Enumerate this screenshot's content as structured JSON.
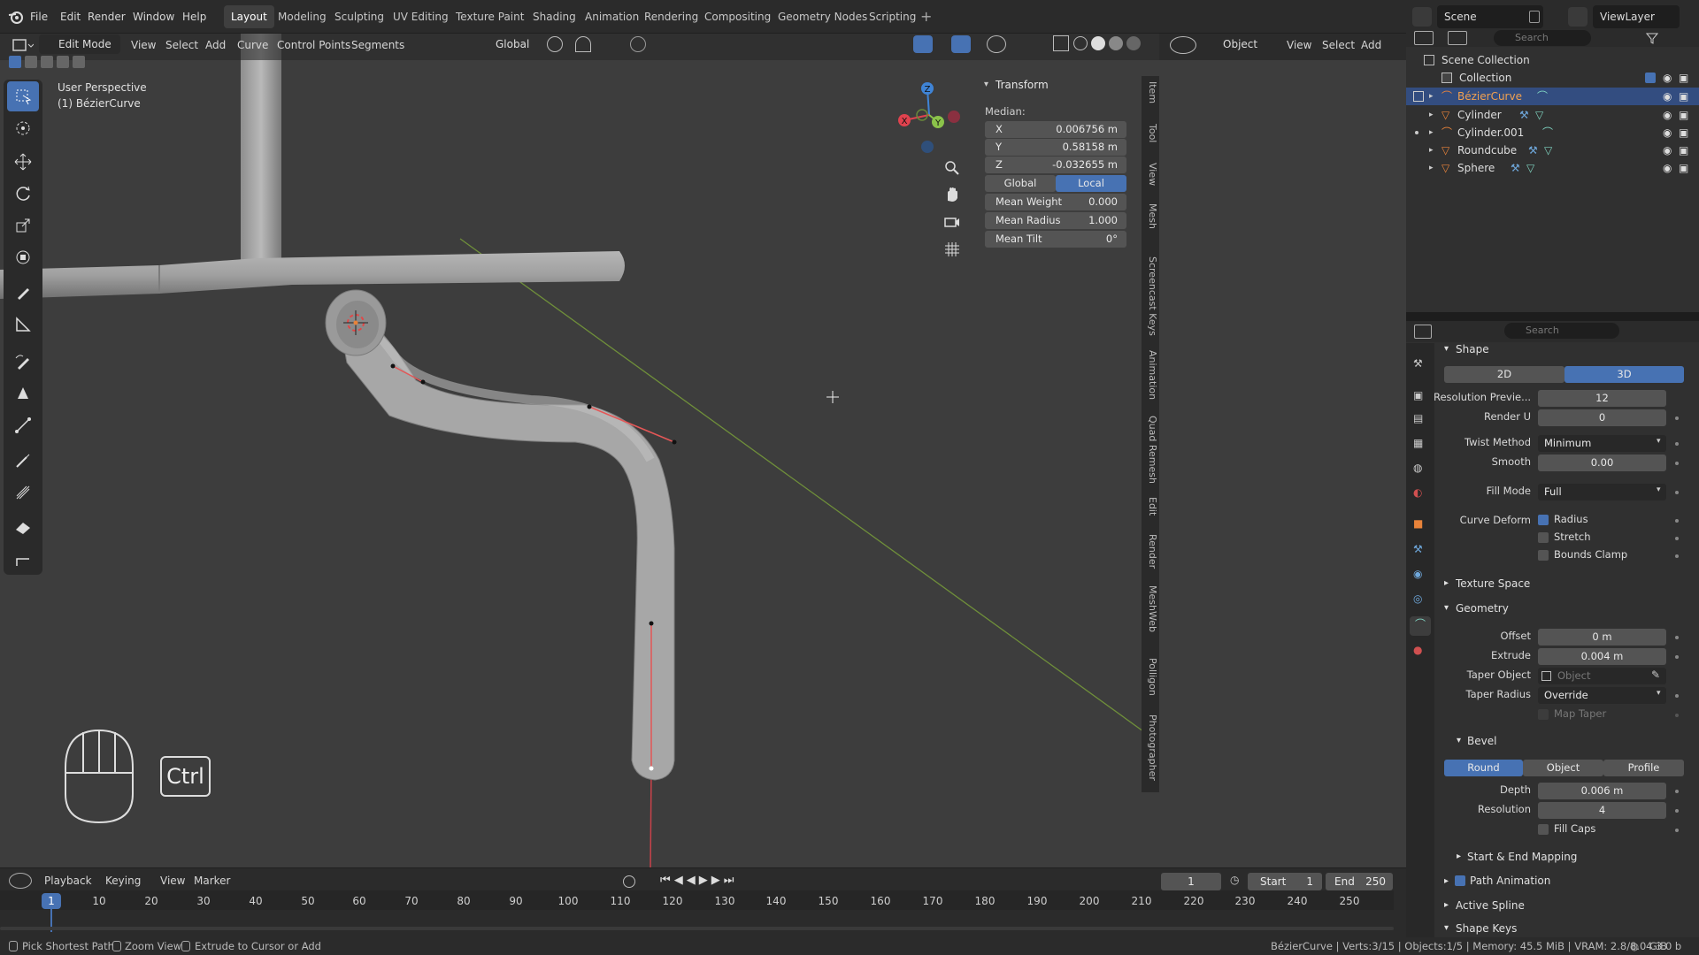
{
  "menu": {
    "file": "File",
    "edit": "Edit",
    "render": "Render",
    "window": "Window",
    "help": "Help"
  },
  "workspaces": [
    "Layout",
    "Modeling",
    "Sculpting",
    "UV Editing",
    "Texture Paint",
    "Shading",
    "Animation",
    "Rendering",
    "Compositing",
    "Geometry Nodes",
    "Scripting"
  ],
  "scene": {
    "label": "Scene",
    "view_layer": "ViewLayer"
  },
  "viewport_header": {
    "mode": "Edit Mode",
    "view": "View",
    "select": "Select",
    "add": "Add",
    "curve": "Curve",
    "control_points": "Control Points",
    "segments": "Segments",
    "orientation": "Global",
    "object_mode": "Object",
    "view2": "View",
    "select2": "Select",
    "add2": "Add",
    "search_placeholder": "Search"
  },
  "viewport": {
    "perspective": "User Perspective",
    "object_name": "(1) BézierCurve",
    "ctrl_key": "Ctrl"
  },
  "gizmo": {
    "x": "X",
    "y": "Y",
    "z": "Z"
  },
  "npanel": {
    "title": "Transform",
    "median": "Median:",
    "x_label": "X",
    "x_value": "0.006756 m",
    "y_label": "Y",
    "y_value": "0.58158 m",
    "z_label": "Z",
    "z_value": "-0.032655 m",
    "global": "Global",
    "local": "Local",
    "mean_weight_label": "Mean Weight",
    "mean_weight": "0.000",
    "mean_radius_label": "Mean Radius",
    "mean_radius": "1.000",
    "mean_tilt_label": "Mean Tilt",
    "mean_tilt": "0°"
  },
  "sidebar_tabs": [
    "Item",
    "Tool",
    "View",
    "Mesh",
    "Screencast Keys",
    "Animation",
    "Quad Remesh",
    "Edit",
    "Render",
    "MeshWeb",
    "Polligon",
    "Photographer"
  ],
  "outliner": {
    "search_placeholder": "Search",
    "scene_collection": "Scene Collection",
    "collection": "Collection",
    "items": [
      {
        "name": "BézierCurve",
        "selected": true
      },
      {
        "name": "Cylinder",
        "selected": false
      },
      {
        "name": "Cylinder.001",
        "selected": false
      },
      {
        "name": "Roundcube",
        "selected": false
      },
      {
        "name": "Sphere",
        "selected": false
      }
    ]
  },
  "properties": {
    "search_placeholder": "Search",
    "shape": "Shape",
    "dim_2d": "2D",
    "dim_3d": "3D",
    "resolution_preview_label": "Resolution Previe...",
    "resolution_preview": "12",
    "render_u_label": "Render U",
    "render_u": "0",
    "twist_method_label": "Twist Method",
    "twist_method": "Minimum",
    "smooth_label": "Smooth",
    "smooth": "0.00",
    "fill_mode_label": "Fill Mode",
    "fill_mode": "Full",
    "curve_deform_label": "Curve Deform",
    "radius": "Radius",
    "stretch": "Stretch",
    "bounds_clamp": "Bounds Clamp",
    "texture_space": "Texture Space",
    "geometry": "Geometry",
    "offset_label": "Offset",
    "offset": "0 m",
    "extrude_label": "Extrude",
    "extrude": "0.004 m",
    "taper_object_label": "Taper Object",
    "taper_object_placeholder": "Object",
    "taper_radius_label": "Taper Radius",
    "taper_radius": "Override",
    "map_taper": "Map Taper",
    "bevel": "Bevel",
    "bevel_round": "Round",
    "bevel_object": "Object",
    "bevel_profile": "Profile",
    "depth_label": "Depth",
    "depth": "0.006 m",
    "resolution_label": "Resolution",
    "resolution": "4",
    "fill_caps": "Fill Caps",
    "start_end_mapping": "Start & End Mapping",
    "path_animation": "Path Animation",
    "active_spline": "Active Spline",
    "shape_keys": "Shape Keys"
  },
  "timeline": {
    "playback": "Playback",
    "keying": "Keying",
    "view": "View",
    "marker": "Marker",
    "current_frame": "1",
    "start_label": "Start",
    "start": "1",
    "end_label": "End",
    "end": "250",
    "ticks": [
      "10",
      "20",
      "30",
      "40",
      "50",
      "60",
      "70",
      "80",
      "90",
      "100",
      "110",
      "120",
      "130",
      "140",
      "150",
      "160",
      "170",
      "180",
      "190",
      "200",
      "210",
      "220",
      "230",
      "240",
      "250"
    ]
  },
  "status": {
    "pick": "Pick Shortest Path",
    "zoom": "Zoom View",
    "extrude": "Extrude to Cursor or Add",
    "info": "BézierCurve | Verts:3/15 | Objects:1/5 | Memory: 45.5 MiB | VRAM: 2.8/8.0 GiB",
    "version": "4.3.0 b"
  },
  "colors": {
    "accent": "#4772b3",
    "selected_row": "#334d80",
    "viewport_bg": "#3d3d3d",
    "x_axis": "#e0424e",
    "y_axis": "#8bc34a",
    "z_axis": "#3f84d6",
    "orange": "#e8833a"
  }
}
